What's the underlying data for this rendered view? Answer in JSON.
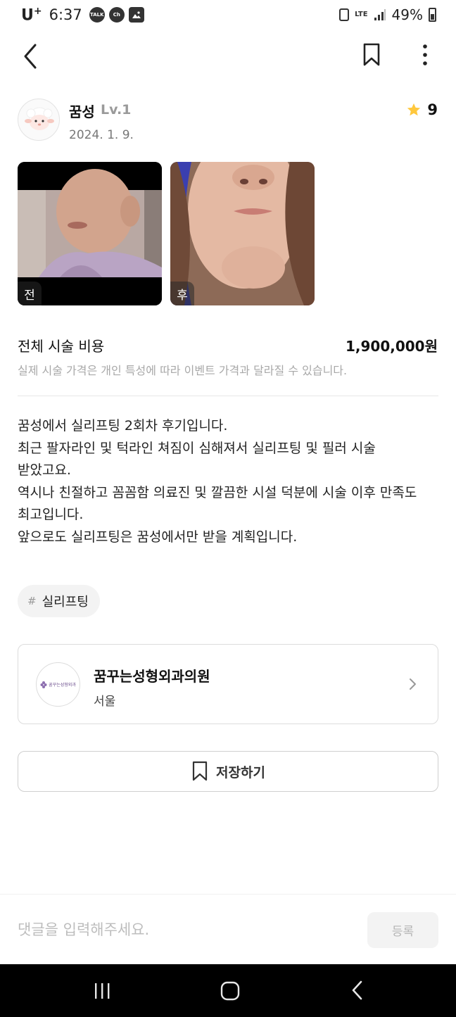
{
  "status_bar": {
    "carrier": "U",
    "carrier_suffix": "+",
    "time": "6:37",
    "notification_icons": [
      "TALK",
      "Ch"
    ],
    "network": "LTE",
    "battery": "49%"
  },
  "post": {
    "author_name": "꿈성",
    "author_level": "Lv.1",
    "date": "2024. 1. 9.",
    "rating": "9",
    "photos": [
      {
        "label": "전"
      },
      {
        "label": "후"
      }
    ],
    "cost_label": "전체 시술 비용",
    "cost_value": "1,900,000원",
    "cost_note": "실제 시술 가격은 개인 특성에 따라 이벤트 가격과 달라질 수 있습니다.",
    "body_lines": [
      "꿈성에서 실리프팅 2회차 후기입니다.",
      "최근 팔자라인 및 턱라인 쳐짐이 심해져서 실리프팅 및 필러 시술",
      "받았고요.",
      "역시나 친절하고 꼼꼼함 의료진 및 깔끔한 시설 덕분에 시술 이후 만족도",
      "최고입니다.",
      "앞으로도 실리프팅은 꿈성에서만 받을 계획입니다."
    ],
    "tag_hash": "#",
    "tag": "실리프팅"
  },
  "hospital": {
    "logo_text": "꿈꾸는성형외과",
    "name": "꿈꾸는성형외과의원",
    "region": "서울"
  },
  "actions": {
    "save_label": "저장하기"
  },
  "comment": {
    "placeholder": "댓글을 입력해주세요.",
    "submit_label": "등록"
  },
  "colors": {
    "star": "#FFC83D",
    "divider": "#E6E6E6",
    "muted_text": "#A8A8A8"
  },
  "icons": [
    "back-arrow-icon",
    "bookmark-icon",
    "more-vertical-icon",
    "star-icon",
    "chevron-right-icon",
    "nav-recents-icon",
    "nav-home-icon",
    "nav-back-icon"
  ]
}
